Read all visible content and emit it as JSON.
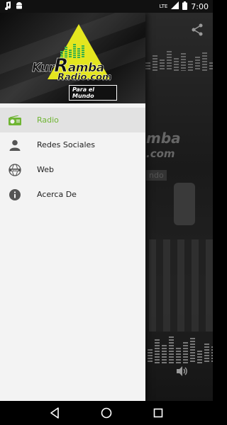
{
  "status_bar": {
    "time": "7:00",
    "network_label": "LTE"
  },
  "logo": {
    "word_prefix": "Kur",
    "word_r": "R",
    "word_suffix": "amba",
    "subline": "Radio.com",
    "tagline": "Para el Mundo"
  },
  "menu": {
    "items": [
      {
        "label": "Radio",
        "icon": "radio-icon",
        "active": true
      },
      {
        "label": "Redes Sociales",
        "icon": "person-icon",
        "active": false
      },
      {
        "label": "Web",
        "icon": "www-globe-icon",
        "active": false
      },
      {
        "label": "Acerca De",
        "icon": "info-icon",
        "active": false
      }
    ]
  },
  "background_app": {
    "logo_fragment": "mba",
    "logo_fragment2": ".com",
    "tag_fragment": "ndo"
  },
  "colors": {
    "accent": "#6fb533",
    "logo_yellow": "#e4e61f",
    "drawer_bg": "#f3f3f3",
    "active_row_bg": "#e2e2e2"
  }
}
